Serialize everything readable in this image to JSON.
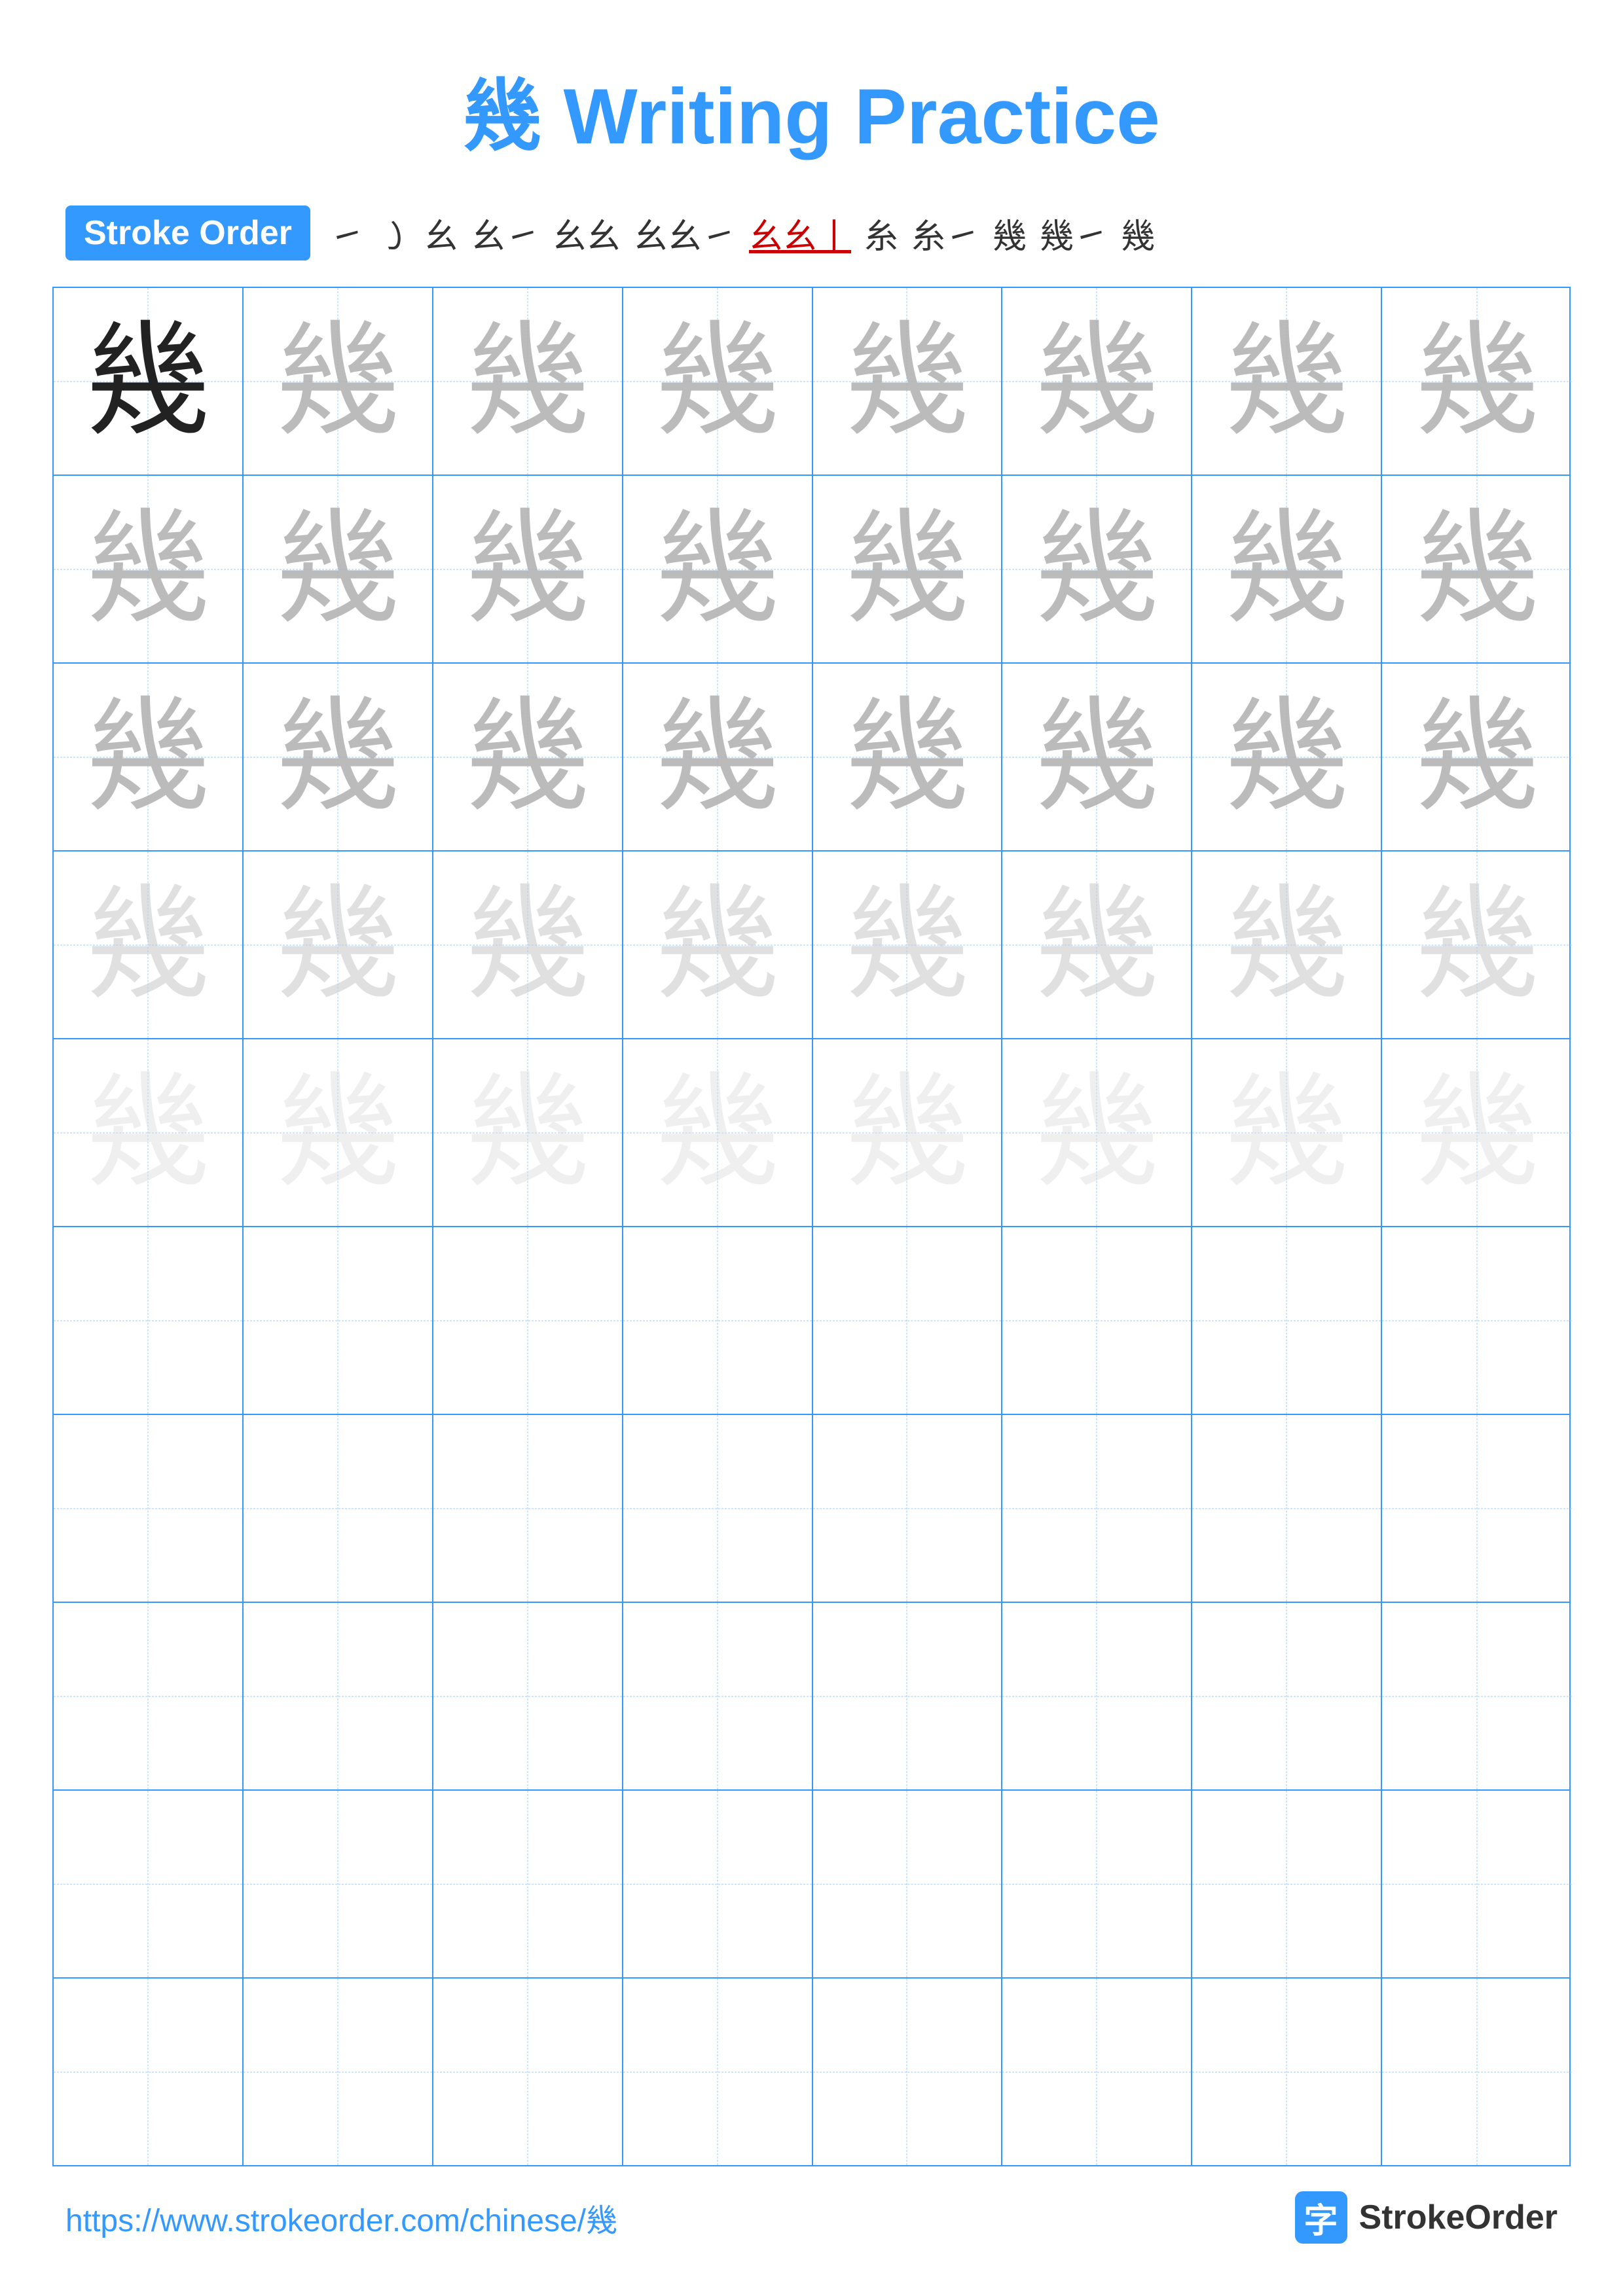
{
  "title": "幾 Writing Practice",
  "character": "幾",
  "stroke_order_label": "Stroke Order",
  "stroke_sequence": [
    "㇀",
    "㇀",
    "幺",
    "幺㇀",
    "幺幺",
    "幺幺㇀",
    "幺幺丨",
    "糸",
    "糸㇀",
    "幾",
    "幾㇀",
    "幾"
  ],
  "stroke_sequence_red_index": 6,
  "footer_url": "https://www.strokeorder.com/chinese/幾",
  "footer_logo_text": "StrokeOrder",
  "rows": [
    {
      "type": "practice",
      "shade": "dark",
      "first_dark": true
    },
    {
      "type": "practice",
      "shade": "medium"
    },
    {
      "type": "practice",
      "shade": "medium"
    },
    {
      "type": "practice",
      "shade": "light"
    },
    {
      "type": "practice",
      "shade": "very-light"
    },
    {
      "type": "empty"
    },
    {
      "type": "empty"
    },
    {
      "type": "empty"
    },
    {
      "type": "empty"
    },
    {
      "type": "empty"
    }
  ],
  "cols_per_row": 8
}
